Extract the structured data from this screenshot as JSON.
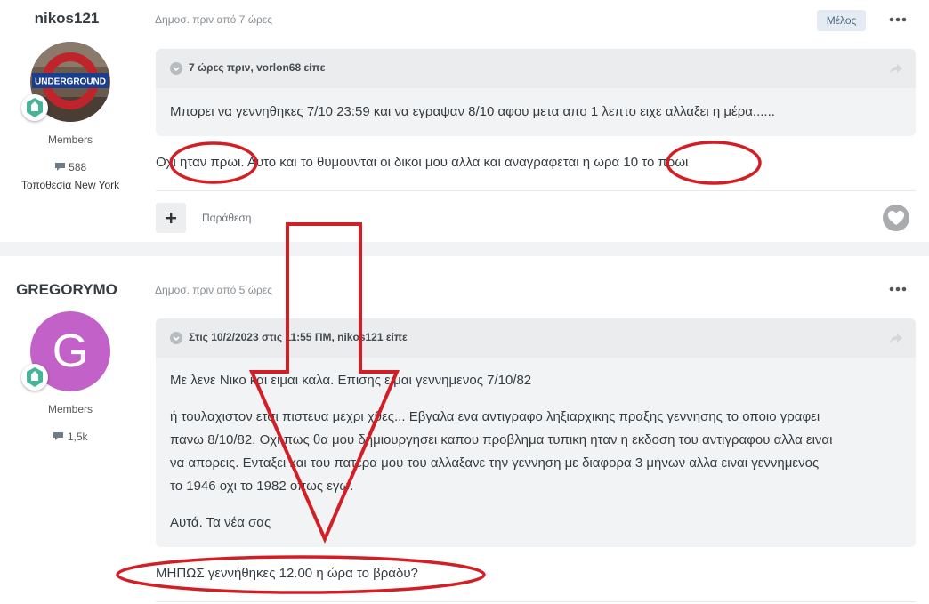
{
  "colors": {
    "annotation": "#d21f26",
    "avatar_g": "#c261c8",
    "badge_teal": "#45b59a",
    "like_gray": "#a9abae"
  },
  "posts": [
    {
      "author": "nikos121",
      "avatar_text": "UNDERGROUND",
      "group": "Members",
      "post_count": "588",
      "location": "Τοποθεσία New York",
      "date": "Δημοσ. πριν από 7 ώρες",
      "member_badge": "Μέλος",
      "quote": {
        "citation": "7 ώρες πριν, vorlon68 είπε",
        "lines": [
          "Μπορει να γεννηθηκες 7/10 23:59 και να εγραψαν 8/10 αφου μετα απο 1 λεπτο ειχε αλλαξει η μέρα......"
        ]
      },
      "body": "Οχι ηταν πρωι. Αυτο και το θυμουνται οι δικοι μου αλλα και αναγραφεται η ωρα 10 το πρωι",
      "quote_action": "Παράθεση",
      "add_icon": "plus-icon",
      "like_icon": "heart-icon"
    },
    {
      "author": "GREGORYMO",
      "avatar_letter": "G",
      "group": "Members",
      "post_count": "1,5k",
      "date": "Δημοσ. πριν από 5 ώρες",
      "quote": {
        "citation": "Στις 10/2/2023 στις 11:55 ΠΜ, nikos121 είπε",
        "paragraphs": [
          [
            "Με λενε Νικο και ειμαι καλα. Επισης ειμαι γεννημενος 7/10/82"
          ],
          [
            "ή τουλαχιστον ετσι πιστευα μεχρι χθες... Εβγαλα ενα αντιγραφο ληξιαρχικης πραξης γεννησης το οποιο γραφει",
            "πανω 8/10/82. Οχι πως θα μου δημιουργησει καπου προβλημα τυπικη ηταν η εκδοση του αντιγραφου αλλα ειναι",
            "να απορεις. Ενταξει και του πατερα μου του αλλαξανε την γεννηση με διαφορα 3 μηνων αλλα ειναι γεννημενος",
            "το 1946 οχι το 1982 οπως εγω."
          ],
          [
            "Αυτά. Τα νέα σας"
          ]
        ]
      },
      "body": "ΜΗΠΩΣ γεννήθηκες 12.00 η ώρα το βράδυ?"
    }
  ]
}
